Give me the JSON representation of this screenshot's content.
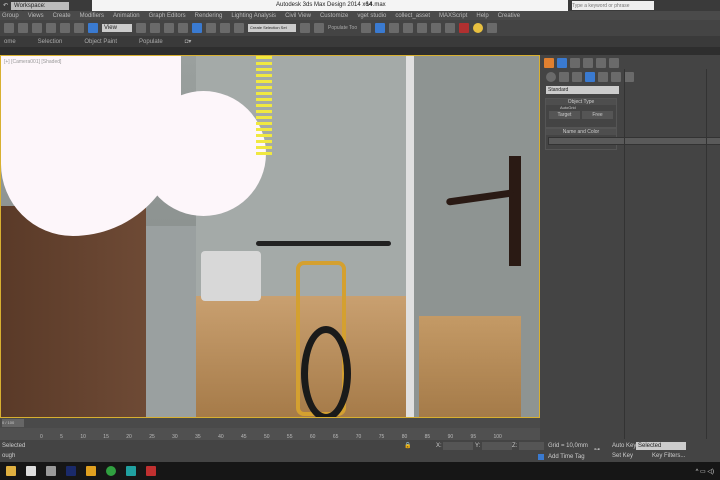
{
  "title": {
    "workspace": "Workspace: Default",
    "app_title": "Autodesk 3ds Max Design 2014 x64",
    "file": "14.max",
    "search_placeholder": "Type a keyword or phrase"
  },
  "menu": [
    "Group",
    "Views",
    "Create",
    "Modifiers",
    "Animation",
    "Graph Editors",
    "Rendering",
    "Lighting Analysis",
    "Civil View",
    "Customize",
    "vget studio",
    "collect_asset",
    "MAXScript",
    "Help",
    "Creative"
  ],
  "toolbar": {
    "view_dropdown": "View",
    "selection_set": "Create Selection Set",
    "populate_label": "Populate Too"
  },
  "ribbon": [
    "ome",
    "Selection",
    "Object Paint",
    "Populate"
  ],
  "viewport": {
    "label": "[+] [Camera001] [Shaded]"
  },
  "cmdpanel": {
    "dropdown": "Standard",
    "object_type": "Object Type",
    "autogrid": "AutoGrid",
    "target": "Target",
    "free": "Free",
    "name_color": "Name and Color",
    "color_swatch": "#c040c0"
  },
  "timeline": {
    "frame": "0 / 100",
    "ticks": [
      "0",
      "5",
      "10",
      "15",
      "20",
      "25",
      "30",
      "35",
      "40",
      "45",
      "50",
      "55",
      "60",
      "65",
      "70",
      "75",
      "80",
      "85",
      "90",
      "95",
      "100"
    ]
  },
  "status": {
    "line1": "Selected",
    "line2": "ough",
    "x": "X:",
    "y": "Y:",
    "z": "Z:",
    "grid": "Grid = 10,0mm",
    "add_time_tag": "Add Time Tag",
    "auto_key": "Auto Key",
    "set_key": "Set Key",
    "selected_dd": "Selected",
    "key_filters": "Key Filters..."
  }
}
